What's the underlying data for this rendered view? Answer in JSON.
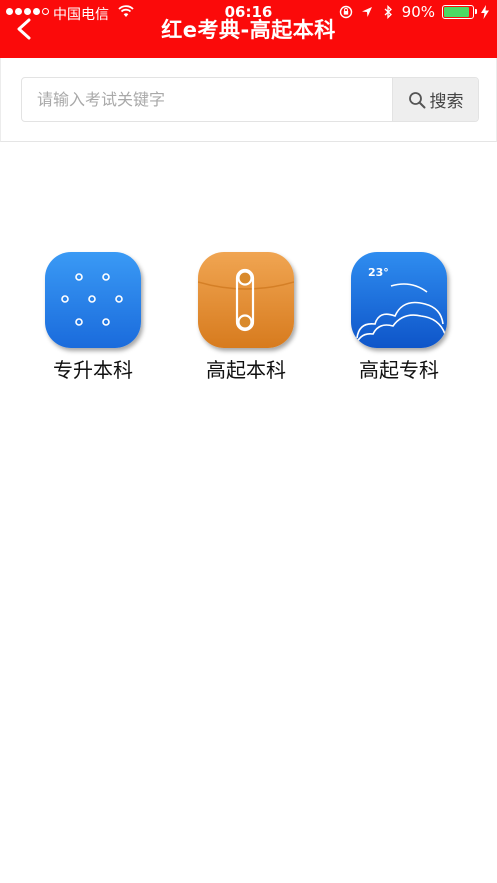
{
  "status_bar": {
    "carrier": "中国电信",
    "time": "06:16",
    "battery_percent": "90%",
    "battery_level": 0.9,
    "icons": [
      "signal-icon",
      "wifi-icon",
      "orientation-lock-icon",
      "location-icon",
      "bluetooth-icon",
      "battery-icon",
      "charging-icon"
    ]
  },
  "header": {
    "title": "红e考典-高起本科",
    "back_icon": "chevron-left-icon"
  },
  "search": {
    "placeholder": "请输入考试关键字",
    "value": "",
    "button_label": "搜索",
    "button_icon": "search-icon"
  },
  "apps": [
    {
      "label": "专升本科",
      "icon": "dots-grid-icon",
      "color": "#1f78e6"
    },
    {
      "label": "高起本科",
      "icon": "envelope-clip-icon",
      "color": "#e38f35"
    },
    {
      "label": "高起专科",
      "icon": "weather-cloud-icon",
      "color": "#1a6bdc",
      "badge": "23°"
    }
  ],
  "colors": {
    "header_bg": "#fb0a0a",
    "battery_fill": "#4cd964"
  }
}
